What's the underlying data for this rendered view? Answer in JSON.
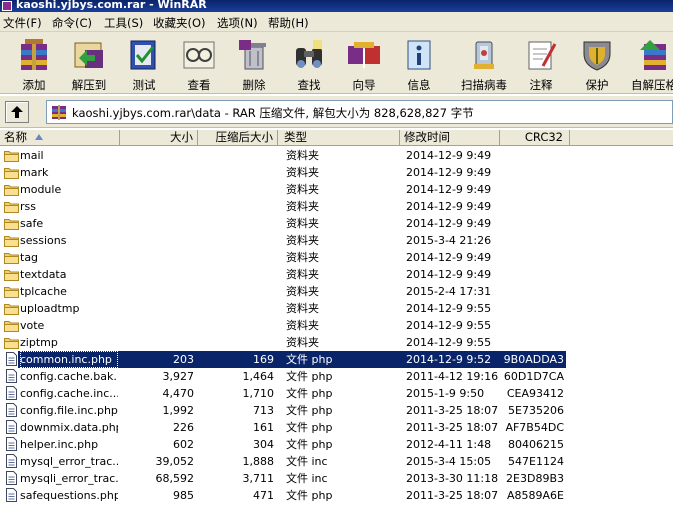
{
  "window": {
    "title": "kaoshi.yjbys.com.rar - WinRAR"
  },
  "menu": [
    "文件(F)",
    "命令(C)",
    "工具(S)",
    "收藏夹(O)",
    "选项(N)",
    "帮助(H)"
  ],
  "toolbar": {
    "buttons": [
      {
        "label": "添加",
        "icon": "add-archive-icon"
      },
      {
        "label": "解压到",
        "icon": "extract-to-icon"
      },
      {
        "label": "测试",
        "icon": "test-icon"
      },
      {
        "label": "查看",
        "icon": "view-icon"
      },
      {
        "label": "删除",
        "icon": "delete-icon"
      },
      {
        "label": "查找",
        "icon": "find-icon"
      },
      {
        "label": "向导",
        "icon": "wizard-icon"
      },
      {
        "label": "信息",
        "icon": "info-icon"
      },
      {
        "label": "扫描病毒",
        "icon": "virus-scan-icon"
      },
      {
        "label": "注释",
        "icon": "comment-icon"
      },
      {
        "label": "保护",
        "icon": "protect-icon"
      },
      {
        "label": "自解压格",
        "icon": "sfx-icon"
      }
    ]
  },
  "address": {
    "path": "kaoshi.yjbys.com.rar\\data - RAR 压缩文件, 解包大小为 828,628,827 字节"
  },
  "columns": {
    "name": "名称",
    "size": "大小",
    "packed": "压缩后大小",
    "type": "类型",
    "mtime": "修改时间",
    "crc": "CRC32"
  },
  "files": [
    {
      "name": "mail",
      "size": "",
      "packed": "",
      "type": "资料夹",
      "mtime": "2014-12-9 9:49",
      "crc": "",
      "kind": "folder"
    },
    {
      "name": "mark",
      "size": "",
      "packed": "",
      "type": "资料夹",
      "mtime": "2014-12-9 9:49",
      "crc": "",
      "kind": "folder"
    },
    {
      "name": "module",
      "size": "",
      "packed": "",
      "type": "资料夹",
      "mtime": "2014-12-9 9:49",
      "crc": "",
      "kind": "folder"
    },
    {
      "name": "rss",
      "size": "",
      "packed": "",
      "type": "资料夹",
      "mtime": "2014-12-9 9:49",
      "crc": "",
      "kind": "folder"
    },
    {
      "name": "safe",
      "size": "",
      "packed": "",
      "type": "资料夹",
      "mtime": "2014-12-9 9:49",
      "crc": "",
      "kind": "folder"
    },
    {
      "name": "sessions",
      "size": "",
      "packed": "",
      "type": "资料夹",
      "mtime": "2015-3-4 21:26",
      "crc": "",
      "kind": "folder"
    },
    {
      "name": "tag",
      "size": "",
      "packed": "",
      "type": "资料夹",
      "mtime": "2014-12-9 9:49",
      "crc": "",
      "kind": "folder"
    },
    {
      "name": "textdata",
      "size": "",
      "packed": "",
      "type": "资料夹",
      "mtime": "2014-12-9 9:49",
      "crc": "",
      "kind": "folder"
    },
    {
      "name": "tplcache",
      "size": "",
      "packed": "",
      "type": "资料夹",
      "mtime": "2015-2-4 17:31",
      "crc": "",
      "kind": "folder"
    },
    {
      "name": "uploadtmp",
      "size": "",
      "packed": "",
      "type": "资料夹",
      "mtime": "2014-12-9 9:55",
      "crc": "",
      "kind": "folder"
    },
    {
      "name": "vote",
      "size": "",
      "packed": "",
      "type": "资料夹",
      "mtime": "2014-12-9 9:55",
      "crc": "",
      "kind": "folder"
    },
    {
      "name": "ziptmp",
      "size": "",
      "packed": "",
      "type": "资料夹",
      "mtime": "2014-12-9 9:55",
      "crc": "",
      "kind": "folder"
    },
    {
      "name": "common.inc.php",
      "size": "203",
      "packed": "169",
      "type": "文件 php",
      "mtime": "2014-12-9 9:52",
      "crc": "9B0ADDA3",
      "kind": "file",
      "selected": true
    },
    {
      "name": "config.cache.bak...",
      "size": "3,927",
      "packed": "1,464",
      "type": "文件 php",
      "mtime": "2011-4-12 19:16",
      "crc": "60D1D7CA",
      "kind": "file"
    },
    {
      "name": "config.cache.inc....",
      "size": "4,470",
      "packed": "1,710",
      "type": "文件 php",
      "mtime": "2015-1-9 9:50",
      "crc": "CEA93412",
      "kind": "file"
    },
    {
      "name": "config.file.inc.php",
      "size": "1,992",
      "packed": "713",
      "type": "文件 php",
      "mtime": "2011-3-25 18:07",
      "crc": "5E735206",
      "kind": "file"
    },
    {
      "name": "downmix.data.php",
      "size": "226",
      "packed": "161",
      "type": "文件 php",
      "mtime": "2011-3-25 18:07",
      "crc": "AF7B54DC",
      "kind": "file"
    },
    {
      "name": "helper.inc.php",
      "size": "602",
      "packed": "304",
      "type": "文件 php",
      "mtime": "2012-4-11 1:48",
      "crc": "80406215",
      "kind": "file"
    },
    {
      "name": "mysql_error_trac...",
      "size": "39,052",
      "packed": "1,888",
      "type": "文件 inc",
      "mtime": "2015-3-4 15:05",
      "crc": "547E1124",
      "kind": "file"
    },
    {
      "name": "mysqli_error_trac...",
      "size": "68,592",
      "packed": "3,711",
      "type": "文件 inc",
      "mtime": "2013-3-30 11:18",
      "crc": "2E3D89B3",
      "kind": "file"
    },
    {
      "name": "safequestions.php",
      "size": "985",
      "packed": "471",
      "type": "文件 php",
      "mtime": "2011-3-25 18:07",
      "crc": "A8589A6E",
      "kind": "file"
    }
  ]
}
